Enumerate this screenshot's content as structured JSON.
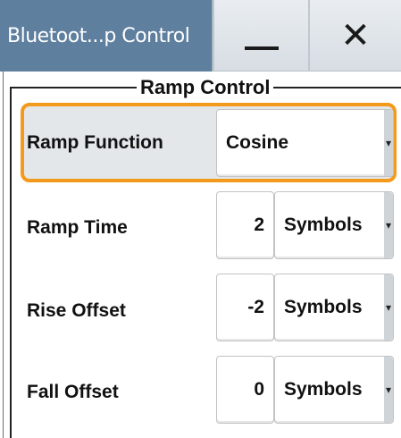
{
  "window": {
    "title": "Bluetoot...p Control",
    "minimize_icon": "minimize-icon",
    "close_icon": "close-icon"
  },
  "group": {
    "title": "Ramp Control"
  },
  "rows": [
    {
      "label": "Ramp Function",
      "value": "Cosine",
      "unit": ""
    },
    {
      "label": "Ramp Time",
      "value": "2",
      "unit": "Symbols"
    },
    {
      "label": "Rise Offset",
      "value": "-2",
      "unit": "Symbols"
    },
    {
      "label": "Fall Offset",
      "value": "0",
      "unit": "Symbols"
    }
  ],
  "colors": {
    "titlebar": "#5f7f9f",
    "focus": "#f39a1c"
  }
}
